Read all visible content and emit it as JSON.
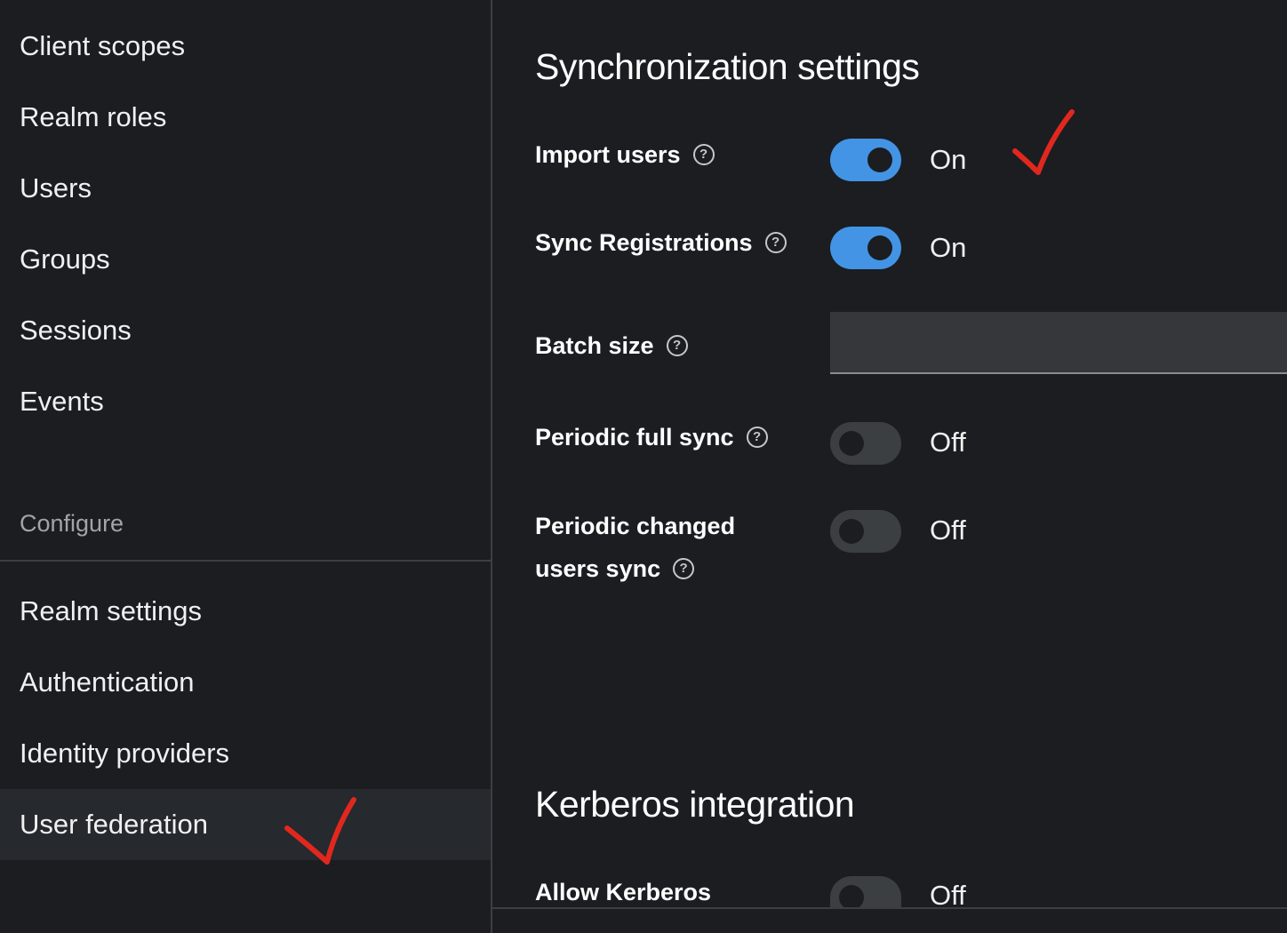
{
  "sidebar": {
    "items_top": [
      {
        "label": "Client scopes"
      },
      {
        "label": "Realm roles"
      },
      {
        "label": "Users"
      },
      {
        "label": "Groups"
      },
      {
        "label": "Sessions"
      },
      {
        "label": "Events"
      }
    ],
    "section_label": "Configure",
    "items_configure": [
      {
        "label": "Realm settings"
      },
      {
        "label": "Authentication"
      },
      {
        "label": "Identity providers"
      },
      {
        "label": "User federation",
        "active": true
      }
    ]
  },
  "main": {
    "sync_title": "Synchronization settings",
    "import_users": {
      "label": "Import users",
      "state": "On"
    },
    "sync_registrations": {
      "label": "Sync Registrations",
      "state": "On"
    },
    "batch_size": {
      "label": "Batch size",
      "value": ""
    },
    "periodic_full_sync": {
      "label": "Periodic full sync",
      "state": "Off"
    },
    "periodic_changed_sync": {
      "label_line1": "Periodic changed",
      "label_line2": "users sync",
      "state": "Off"
    },
    "kerberos_title": "Kerberos integration",
    "allow_kerberos": {
      "label": "Allow Kerberos",
      "state": "Off"
    }
  },
  "help_glyph": "?",
  "colors": {
    "accent": "#4394e5",
    "background": "#1b1d21",
    "annotation": "#e0281e"
  },
  "icons": [
    "help-circle-icon",
    "checkmark-annotation-icon"
  ]
}
